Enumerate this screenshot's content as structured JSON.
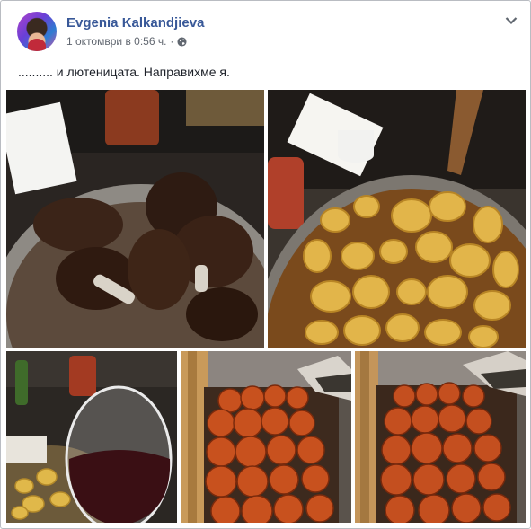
{
  "post": {
    "author": "Evgenia Kalkandjieva",
    "timestamp": "1 октомври в 0:56 ч.",
    "separator": "·",
    "privacy_icon": "globe-icon",
    "menu_icon": "chevron-down-icon",
    "text": ".......... и лютеницата. Направихме я."
  },
  "colors": {
    "author_link": "#385898",
    "meta_text": "#616770",
    "border": "#b9bcc2"
  }
}
